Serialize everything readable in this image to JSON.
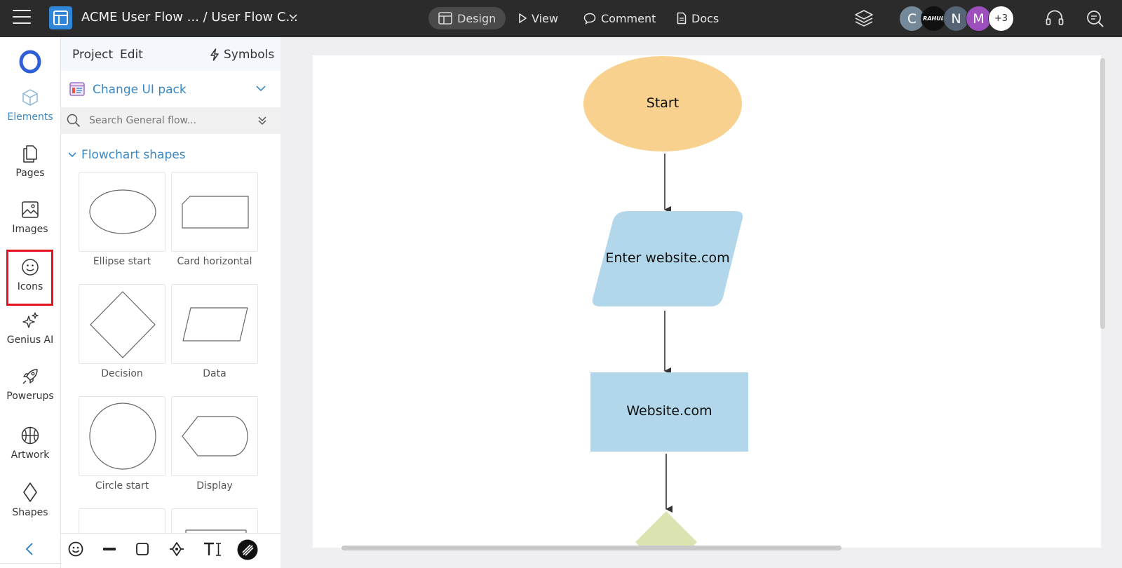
{
  "header": {
    "breadcrumb": "ACME User Flow ... / User Flow C...",
    "nav": [
      {
        "label": "Design",
        "icon": "layout-icon",
        "active": true
      },
      {
        "label": "View",
        "icon": "play-icon",
        "active": false
      },
      {
        "label": "Comment",
        "icon": "speech-bubble-icon",
        "active": false
      },
      {
        "label": "Docs",
        "icon": "document-icon",
        "active": false
      }
    ],
    "avatars": [
      {
        "initial": "C",
        "color": "#748a9b"
      },
      {
        "initial": "RAHUL",
        "color": "#111111"
      },
      {
        "initial": "N",
        "color": "#556575"
      },
      {
        "initial": "M",
        "color": "#9c4fbd"
      }
    ],
    "more_avatars": "+3"
  },
  "rail": {
    "items": [
      {
        "label": "Elements",
        "icon": "cube-icon",
        "active": true
      },
      {
        "label": "Pages",
        "icon": "pages-icon"
      },
      {
        "label": "Images",
        "icon": "image-icon"
      },
      {
        "label": "Icons",
        "icon": "smiley-icon",
        "highlighted": true
      },
      {
        "label": "Genius AI",
        "icon": "sparkle-icon"
      },
      {
        "label": "Powerups",
        "icon": "rocket-icon"
      },
      {
        "label": "Artwork",
        "icon": "ball-icon"
      },
      {
        "label": "Shapes",
        "icon": "diamond-icon"
      }
    ]
  },
  "panel": {
    "tabs": {
      "project": "Project",
      "edit": "Edit",
      "symbols": "Symbols"
    },
    "ui_pack_label": "Change UI pack",
    "search_placeholder": "Search General flow...",
    "section_title": "Flowchart shapes",
    "shapes": [
      {
        "label": "Ellipse start"
      },
      {
        "label": "Card horizontal"
      },
      {
        "label": "Decision"
      },
      {
        "label": "Data"
      },
      {
        "label": "Circle start"
      },
      {
        "label": "Display"
      }
    ]
  },
  "canvas": {
    "nodes": [
      {
        "type": "ellipse",
        "label": "Start",
        "fill": "#f8d18f"
      },
      {
        "type": "parallelogram",
        "label": "Enter website.com",
        "fill": "#b2d7ea"
      },
      {
        "type": "rectangle",
        "label": "Website.com",
        "fill": "#b2d7ea"
      },
      {
        "type": "decision",
        "label": "",
        "fill": "#dbe3b1"
      }
    ]
  },
  "colors": {
    "accent": "#3b88c3",
    "topbar": "#2b2b2b",
    "highlight": "#e3121d"
  }
}
